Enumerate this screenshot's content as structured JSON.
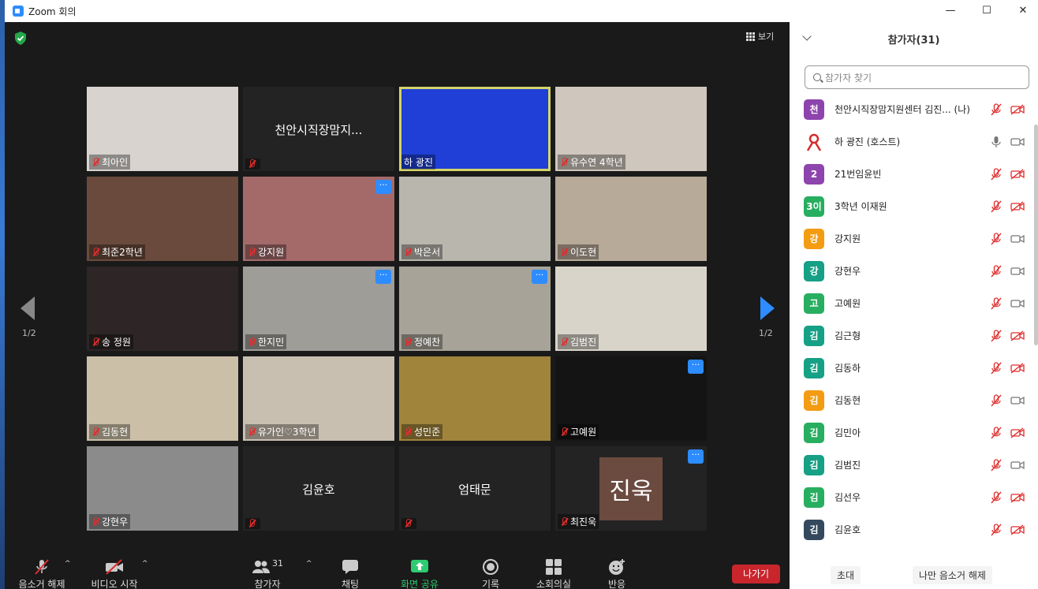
{
  "window": {
    "title": "Zoom 회의"
  },
  "meeting": {
    "view_label": "보기",
    "page_left": "1/2",
    "page_right": "1/2"
  },
  "tiles": [
    {
      "name": "최아인",
      "center": "",
      "more": false,
      "bg": "#d8d3cf"
    },
    {
      "name": "",
      "center": "천안시직장맘지...",
      "more": false,
      "bg": "#232323"
    },
    {
      "name": "하 광진",
      "center": "",
      "more": false,
      "bg": "#1f3fd6",
      "active": true
    },
    {
      "name": "유수연 4학년",
      "center": "",
      "more": false,
      "bg": "#cfc6bd"
    },
    {
      "name": "최준2학년",
      "center": "",
      "more": false,
      "bg": "#6a4a3c"
    },
    {
      "name": "강지원",
      "center": "",
      "more": true,
      "bg": "#a46a6a"
    },
    {
      "name": "박은서",
      "center": "",
      "more": false,
      "bg": "#b9b6ae"
    },
    {
      "name": "이도현",
      "center": "",
      "more": false,
      "bg": "#b8aa98"
    },
    {
      "name": "송 정원",
      "center": "",
      "more": false,
      "bg": "#2d2526"
    },
    {
      "name": "한지민",
      "center": "",
      "more": true,
      "bg": "#9e9d98"
    },
    {
      "name": "정예찬",
      "center": "",
      "more": true,
      "bg": "#a7a398"
    },
    {
      "name": "김범진",
      "center": "",
      "more": false,
      "bg": "#d9d4c9"
    },
    {
      "name": "김동현",
      "center": "",
      "more": false,
      "bg": "#cbbfa7"
    },
    {
      "name": "유가인♡3학년",
      "center": "",
      "more": false,
      "bg": "#c9bfb1"
    },
    {
      "name": "성민준",
      "center": "",
      "more": false,
      "bg": "#a0843c"
    },
    {
      "name": "고예원",
      "center": "",
      "more": true,
      "bg": "#141414"
    },
    {
      "name": "강현우",
      "center": "",
      "more": false,
      "bg": "#8b8b8c"
    },
    {
      "name": "",
      "center": "김윤호",
      "more": false,
      "bg": "#232323"
    },
    {
      "name": "",
      "center": "엄태문",
      "more": false,
      "bg": "#232323"
    },
    {
      "name": "최진욱",
      "center": "",
      "more": true,
      "bg": "#232323",
      "avatar": "진욱"
    }
  ],
  "toolbar": {
    "unmute": "음소거 해제",
    "start_video": "비디오 시작",
    "participants": "참가자",
    "participants_count": "31",
    "chat": "채팅",
    "share_screen": "화면 공유",
    "record": "기록",
    "breakout": "소회의실",
    "reactions": "반응",
    "leave": "나가기"
  },
  "panel": {
    "title": "참가자(31)",
    "search_placeholder": "참가자 찾기",
    "invite": "초대",
    "unmute_me": "나만 음소거 해제",
    "participants": [
      {
        "initial": "천",
        "color": "#8e44ad",
        "name": "천안시직장맘지원센터 김진... (나)",
        "mic": "muted",
        "cam": "off"
      },
      {
        "initial": "",
        "color": "#ffffff",
        "name": "하 광진 (호스트)",
        "mic": "on",
        "cam": "on",
        "logo": true
      },
      {
        "initial": "2",
        "color": "#8e44ad",
        "name": "21번임윤빈",
        "mic": "muted",
        "cam": "off"
      },
      {
        "initial": "3이",
        "color": "#27ae60",
        "name": "3학년 이재원",
        "mic": "muted",
        "cam": "off"
      },
      {
        "initial": "강",
        "color": "#f39c12",
        "name": "강지원",
        "mic": "muted",
        "cam": "on"
      },
      {
        "initial": "강",
        "color": "#16a085",
        "name": "강현우",
        "mic": "muted",
        "cam": "on"
      },
      {
        "initial": "고",
        "color": "#27ae60",
        "name": "고예원",
        "mic": "muted",
        "cam": "on"
      },
      {
        "initial": "김",
        "color": "#16a085",
        "name": "김근형",
        "mic": "muted",
        "cam": "off"
      },
      {
        "initial": "김",
        "color": "#16a085",
        "name": "김동하",
        "mic": "muted",
        "cam": "off"
      },
      {
        "initial": "김",
        "color": "#f39c12",
        "name": "김동현",
        "mic": "muted",
        "cam": "on"
      },
      {
        "initial": "김",
        "color": "#27ae60",
        "name": "김민아",
        "mic": "muted",
        "cam": "off"
      },
      {
        "initial": "김",
        "color": "#16a085",
        "name": "김범진",
        "mic": "muted",
        "cam": "on"
      },
      {
        "initial": "김",
        "color": "#27ae60",
        "name": "김선우",
        "mic": "muted",
        "cam": "off"
      },
      {
        "initial": "김",
        "color": "#34495e",
        "name": "김윤호",
        "mic": "muted",
        "cam": "off"
      }
    ]
  }
}
